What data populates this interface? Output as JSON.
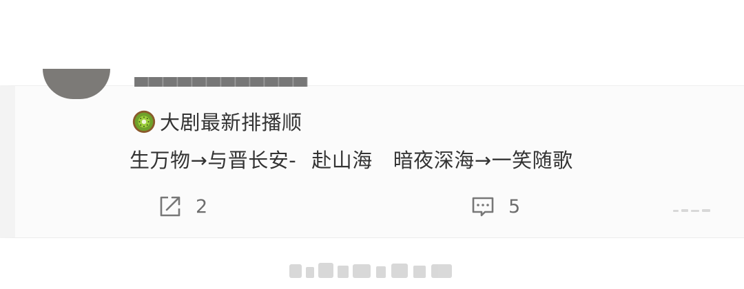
{
  "post": {
    "headline": "大剧最新排播顺",
    "schedule_parts": [
      "生万物→与晋长安-",
      "赴山海",
      "暗夜深海→一笑随歌"
    ],
    "icon": "kiwi-fruit-icon"
  },
  "actions": {
    "share": {
      "icon": "share-icon",
      "count": "2"
    },
    "comment": {
      "icon": "comment-icon",
      "count": "5"
    }
  },
  "colors": {
    "text": "#333333",
    "muted": "#6d6d6d",
    "card_bg": "#fbfbfb",
    "avatar": "#7c7a77",
    "kiwi_skin": "#8a5a2b",
    "kiwi_flesh": "#6fa12a"
  }
}
